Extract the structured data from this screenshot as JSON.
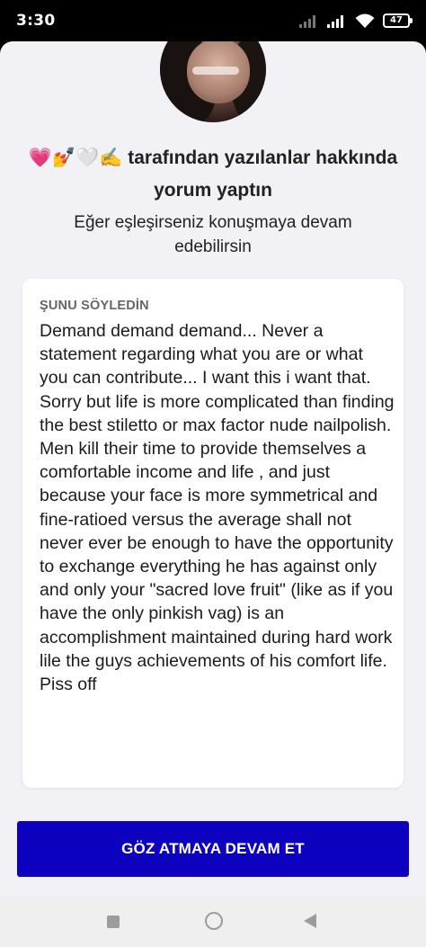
{
  "status": {
    "time": "3:30",
    "battery": "47",
    "icons": [
      "signal-icon",
      "signal-icon",
      "wifi-icon",
      "battery-icon"
    ]
  },
  "header": {
    "emojis": "💗💅🤍✍️",
    "title_rest": " tarafından yazılanlar hakkında yorum yaptın",
    "subtitle": "Eğer eşleşirseniz konuşmaya devam edebilirsin"
  },
  "card": {
    "label": "ŞUNU SÖYLEDİN",
    "text": "Demand demand demand... Never a statement regarding what you are or what you can contribute... I want this i want that. Sorry but life is more complicated than finding the best stiletto or max factor nude nailpolish. Men kill their time to provide themselves a comfortable income and life , and just because your face is more symmetrical and fine-ratioed versus the average shall not never ever be enough to have the opportunity to exchange everything he has against only and only your \"sacred love fruit\" (like as if you have the only pinkish vag) is an accomplishment maintained during hard work lile the guys achievements of his comfort life. Piss off"
  },
  "button": {
    "label": "GÖZ ATMAYA DEVAM ET"
  },
  "colors": {
    "accent": "#0c01bf",
    "sheet_bg": "#f1f1f6",
    "card_bg": "#ffffff"
  }
}
